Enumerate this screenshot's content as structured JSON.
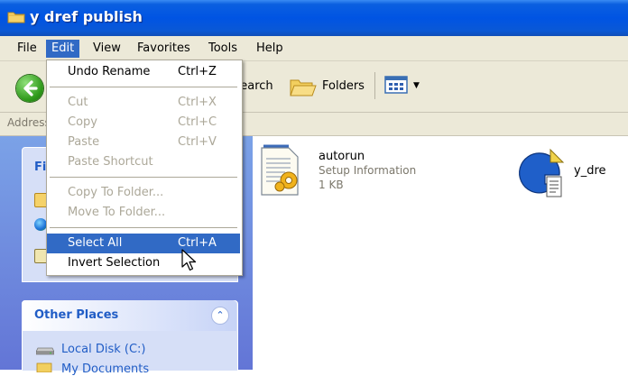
{
  "window": {
    "title": "y dref publish"
  },
  "menubar": {
    "items": [
      "File",
      "Edit",
      "View",
      "Favorites",
      "Tools",
      "Help"
    ],
    "active": "Edit"
  },
  "toolbar": {
    "search_label": "Search",
    "folders_label": "Folders"
  },
  "addressbar": {
    "label": "Address"
  },
  "tasks": {
    "header_partial": "Fi"
  },
  "other_places": {
    "title": "Other Places",
    "links": [
      "Local Disk (C:)",
      "My Documents"
    ]
  },
  "files": [
    {
      "name": "autorun",
      "type": "Setup Information",
      "size": "1 KB",
      "icon": "settings-file-icon"
    },
    {
      "name": "y_dre",
      "icon": "setup-program-icon"
    }
  ],
  "edit_menu": {
    "items": [
      {
        "label": "Undo Rename",
        "shortcut": "Ctrl+Z",
        "enabled": true
      },
      {
        "label": "Cut",
        "shortcut": "Ctrl+X",
        "enabled": false
      },
      {
        "label": "Copy",
        "shortcut": "Ctrl+C",
        "enabled": false
      },
      {
        "label": "Paste",
        "shortcut": "Ctrl+V",
        "enabled": false
      },
      {
        "label": "Paste Shortcut",
        "shortcut": "",
        "enabled": false
      },
      {
        "label": "Copy To Folder...",
        "shortcut": "",
        "enabled": false
      },
      {
        "label": "Move To Folder...",
        "shortcut": "",
        "enabled": false
      },
      {
        "label": "Select All",
        "shortcut": "Ctrl+A",
        "enabled": true,
        "highlighted": true
      },
      {
        "label": "Invert Selection",
        "shortcut": "",
        "enabled": true
      }
    ]
  },
  "colors": {
    "titlebar": "#0054e3",
    "menu_highlight": "#316ac5",
    "link": "#215dc6",
    "disabled": "#aca899"
  }
}
